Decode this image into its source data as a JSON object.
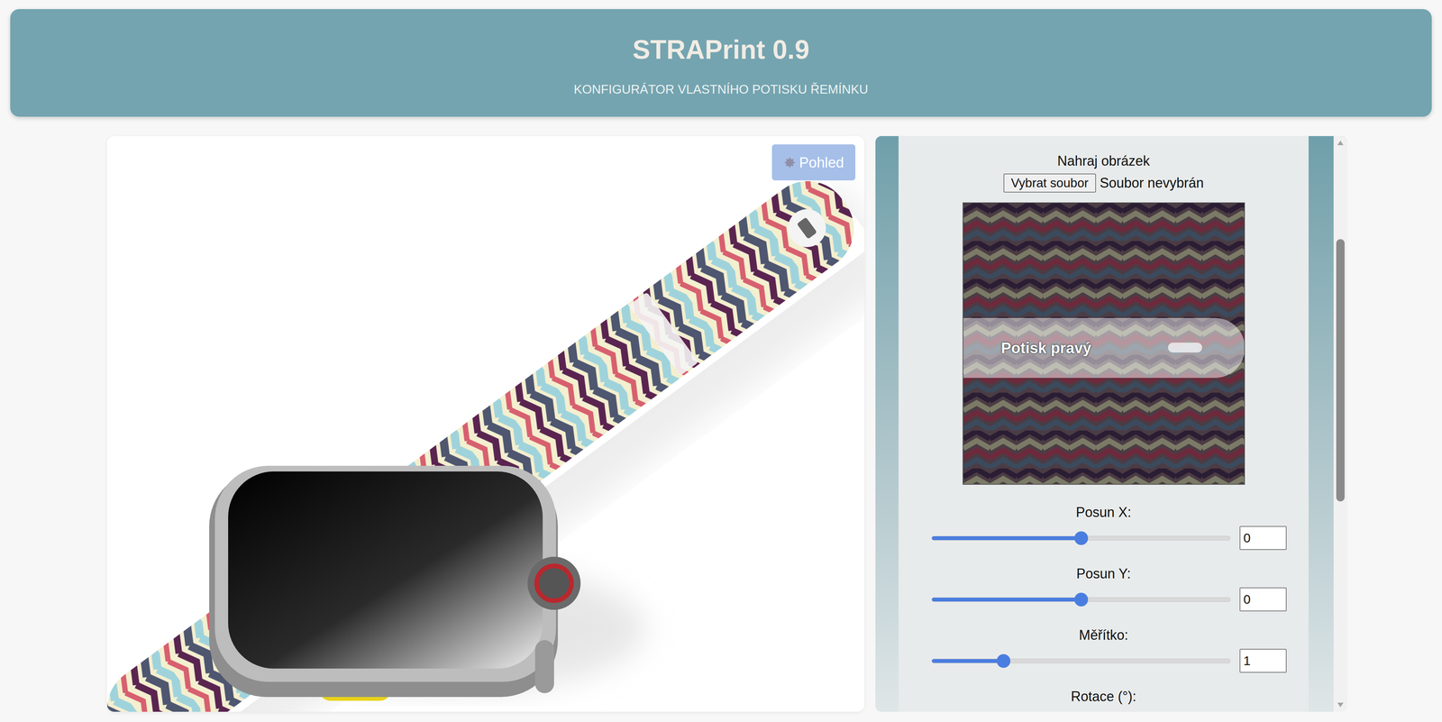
{
  "header": {
    "title": "STRAPrint 0.9",
    "subtitle": "KONFIGURÁTOR VLASTNÍHO POTISKU ŘEMÍNKU"
  },
  "view_button": {
    "label": "Pohled"
  },
  "upload": {
    "label": "Nahraj obrázek",
    "button": "Vybrat soubor",
    "file_status": "Soubor nevybrán"
  },
  "preview": {
    "overlay_label": "Potisk pravý"
  },
  "controls": [
    {
      "kind": "slider",
      "label": "Posun X:",
      "level": 0.5,
      "value": "0"
    },
    {
      "kind": "slider",
      "label": "Posun Y:",
      "level": 0.5,
      "value": "0"
    },
    {
      "kind": "slider",
      "label": "Měřítko:",
      "level": 0.24,
      "value": "1"
    },
    {
      "kind": "cut",
      "label": "Rotace (°):"
    }
  ]
}
